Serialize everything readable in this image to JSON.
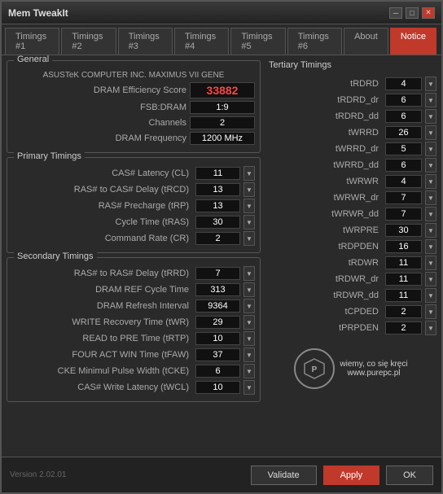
{
  "window": {
    "title": "Mem TweakIt",
    "controls": {
      "minimize": "─",
      "maximize": "□",
      "close": "✕"
    }
  },
  "tabs": [
    {
      "label": "Timings #1",
      "active": false
    },
    {
      "label": "Timings #2",
      "active": false
    },
    {
      "label": "Timings #3",
      "active": false
    },
    {
      "label": "Timings #4",
      "active": false
    },
    {
      "label": "Timings #5",
      "active": false
    },
    {
      "label": "Timings #6",
      "active": false
    },
    {
      "label": "About",
      "active": false
    },
    {
      "label": "Notice",
      "active": true
    }
  ],
  "general": {
    "label": "General",
    "mobo": "ASUSTeK COMPUTER INC. MAXIMUS VII GENE",
    "fields": [
      {
        "label": "DRAM Efficiency Score",
        "value": "33882",
        "highlight": true
      },
      {
        "label": "FSB:DRAM",
        "value": "1:9"
      },
      {
        "label": "Channels",
        "value": "2"
      },
      {
        "label": "DRAM Frequency",
        "value": "1200 MHz"
      }
    ]
  },
  "primary": {
    "label": "Primary Timings",
    "rows": [
      {
        "label": "CAS# Latency (CL)",
        "value": "11"
      },
      {
        "label": "RAS# to CAS# Delay (tRCD)",
        "value": "13"
      },
      {
        "label": "RAS# Precharge (tRP)",
        "value": "13"
      },
      {
        "label": "Cycle Time (tRAS)",
        "value": "30"
      },
      {
        "label": "Command Rate (CR)",
        "value": "2"
      }
    ]
  },
  "secondary": {
    "label": "Secondary Timings",
    "rows": [
      {
        "label": "RAS# to RAS# Delay (tRRD)",
        "value": "7"
      },
      {
        "label": "DRAM REF Cycle Time",
        "value": "313"
      },
      {
        "label": "DRAM Refresh Interval",
        "value": "9364"
      },
      {
        "label": "WRITE Recovery Time (tWR)",
        "value": "29"
      },
      {
        "label": "READ to PRE Time (tRTP)",
        "value": "10"
      },
      {
        "label": "FOUR ACT WIN Time (tFAW)",
        "value": "37"
      },
      {
        "label": "CKE Minimul Pulse Width (tCKE)",
        "value": "6"
      },
      {
        "label": "CAS# Write Latency (tWCL)",
        "value": "10"
      }
    ]
  },
  "tertiary": {
    "label": "Tertiary Timings",
    "rows": [
      {
        "label": "tRDRD",
        "value": "4"
      },
      {
        "label": "tRDRD_dr",
        "value": "6"
      },
      {
        "label": "tRDRD_dd",
        "value": "6"
      },
      {
        "label": "tWRRD",
        "value": "26"
      },
      {
        "label": "tWRRD_dr",
        "value": "5"
      },
      {
        "label": "tWRRD_dd",
        "value": "6"
      },
      {
        "label": "tWRWR",
        "value": "4"
      },
      {
        "label": "tWRWR_dr",
        "value": "7"
      },
      {
        "label": "tWRWR_dd",
        "value": "7"
      },
      {
        "label": "tWRPRE",
        "value": "30"
      },
      {
        "label": "tRDPDEN",
        "value": "16"
      },
      {
        "label": "tRDWR",
        "value": "11"
      },
      {
        "label": "tRDWR_dr",
        "value": "11"
      },
      {
        "label": "tRDWR_dd",
        "value": "11"
      },
      {
        "label": "tCPDED",
        "value": "2"
      },
      {
        "label": "tPRPDEN",
        "value": "2"
      }
    ]
  },
  "logo": {
    "icon": "⚙",
    "line1": "wiemy, co się kręci",
    "line2": "www.purepc.pl"
  },
  "bottom": {
    "version": "Version 2.02.01",
    "buttons": {
      "validate": "Validate",
      "apply": "Apply",
      "ok": "OK"
    }
  }
}
